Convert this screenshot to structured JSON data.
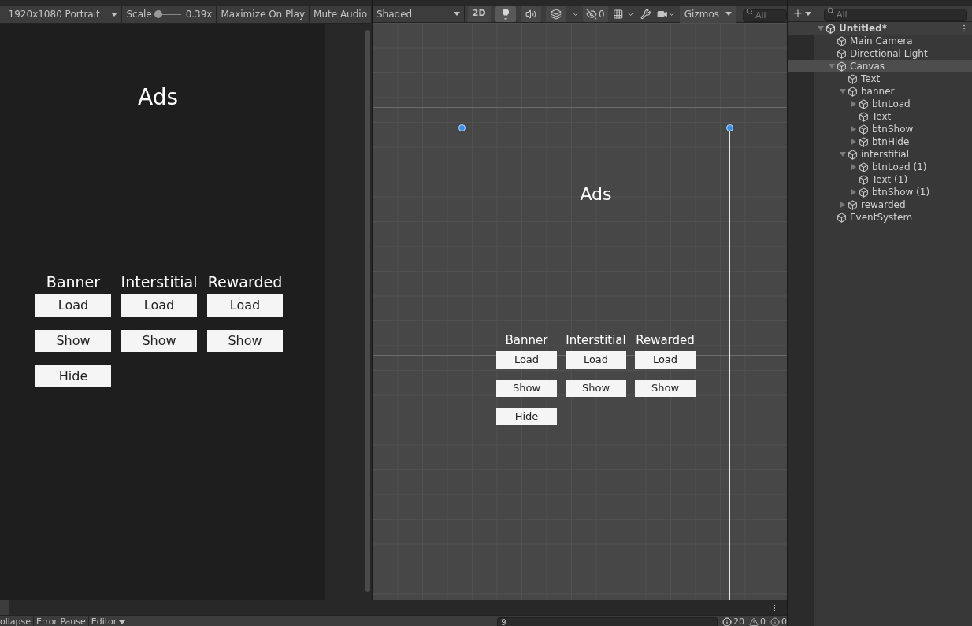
{
  "game_view": {
    "toolbar": {
      "resolution": "1920x1080 Portrait",
      "scale_label": "Scale",
      "scale_slider": {
        "level": 0.05
      },
      "scale_value": "0.39x",
      "buttons": [
        {
          "label": "Maximize On Play",
          "on": false
        },
        {
          "label": "Mute Audio",
          "on": false
        }
      ]
    },
    "screen": {
      "title": "Ads",
      "columns": [
        {
          "heading": "Banner",
          "buttons": [
            "Load",
            "Show",
            "Hide"
          ]
        },
        {
          "heading": "Interstitial",
          "buttons": [
            "Load",
            "Show"
          ]
        },
        {
          "heading": "Rewarded",
          "buttons": [
            "Load",
            "Show"
          ]
        }
      ]
    }
  },
  "scene_view": {
    "toolbar": {
      "shading": "Shaded",
      "toggles": [
        {
          "kind": "dimension",
          "label": "2D",
          "on": false
        },
        {
          "kind": "lighting",
          "on": true
        },
        {
          "kind": "audio",
          "on": false
        },
        {
          "kind": "effects",
          "on": false
        }
      ],
      "hidden_count": "0",
      "gizmos": "Gizmos",
      "search": {
        "placeholder": "All"
      }
    },
    "canvas": {
      "title": "Ads",
      "columns": [
        {
          "heading": "Banner",
          "buttons": [
            "Load",
            "Show",
            "Hide"
          ]
        },
        {
          "heading": "Interstitial",
          "buttons": [
            "Load",
            "Show"
          ]
        },
        {
          "heading": "Rewarded",
          "buttons": [
            "Load",
            "Show"
          ]
        }
      ]
    }
  },
  "hierarchy": {
    "search": {
      "placeholder": "All"
    },
    "tree": [
      {
        "label": "Untitled*",
        "kind": "scene",
        "selected": false,
        "expanded": true,
        "children": [
          {
            "label": "Main Camera",
            "kind": "object",
            "selected": false
          },
          {
            "label": "Directional Light",
            "kind": "object",
            "selected": false
          },
          {
            "label": "Canvas",
            "kind": "object",
            "selected": true,
            "expanded": true,
            "children": [
              {
                "label": "Text",
                "kind": "object",
                "selected": false
              },
              {
                "label": "banner",
                "kind": "object",
                "selected": false,
                "expanded": true,
                "children": [
                  {
                    "label": "btnLoad",
                    "kind": "object",
                    "selected": false,
                    "expanded": false
                  },
                  {
                    "label": "Text",
                    "kind": "object",
                    "selected": false
                  },
                  {
                    "label": "btnShow",
                    "kind": "object",
                    "selected": false,
                    "expanded": false
                  },
                  {
                    "label": "btnHide",
                    "kind": "object",
                    "selected": false,
                    "expanded": false
                  }
                ]
              },
              {
                "label": "interstitial",
                "kind": "object",
                "selected": false,
                "expanded": true,
                "children": [
                  {
                    "label": "btnLoad (1)",
                    "kind": "object",
                    "selected": false,
                    "expanded": false
                  },
                  {
                    "label": "Text (1)",
                    "kind": "object",
                    "selected": false
                  },
                  {
                    "label": "btnShow (1)",
                    "kind": "object",
                    "selected": false,
                    "expanded": false
                  }
                ]
              },
              {
                "label": "rewarded",
                "kind": "object",
                "selected": false,
                "expanded": false
              }
            ]
          },
          {
            "label": "EventSystem",
            "kind": "object",
            "selected": false
          }
        ]
      }
    ]
  },
  "console": {
    "buttons": [
      {
        "label": "ollapse",
        "on": false
      },
      {
        "label": "Error Pause",
        "on": false
      }
    ],
    "dropdown": "Editor",
    "search": {
      "value": "9"
    },
    "counts": [
      {
        "kind": "info",
        "label": "20"
      },
      {
        "kind": "warning",
        "label": "0"
      },
      {
        "kind": "error",
        "label": "0"
      }
    ]
  }
}
